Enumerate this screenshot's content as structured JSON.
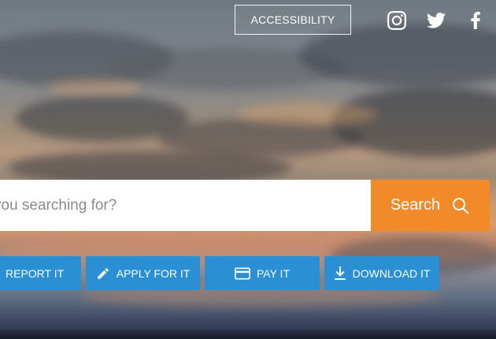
{
  "header": {
    "accessibility_label": "ACCESSIBILITY",
    "social_icons": [
      "instagram-icon",
      "twitter-icon",
      "facebook-icon"
    ]
  },
  "search": {
    "placeholder": "you searching for?",
    "value": "",
    "button_label": "Search",
    "button_icon": "search-icon",
    "button_color": "#f28a2a"
  },
  "actions": [
    {
      "label": "REPORT IT",
      "icon": ""
    },
    {
      "label": "APPLY FOR IT",
      "icon": "pencil-icon"
    },
    {
      "label": "PAY IT",
      "icon": "credit-card-icon"
    },
    {
      "label": "DOWNLOAD IT",
      "icon": "download-icon"
    }
  ],
  "colors": {
    "action_blue": "#2a8fd3",
    "search_orange": "#f28a2a"
  }
}
